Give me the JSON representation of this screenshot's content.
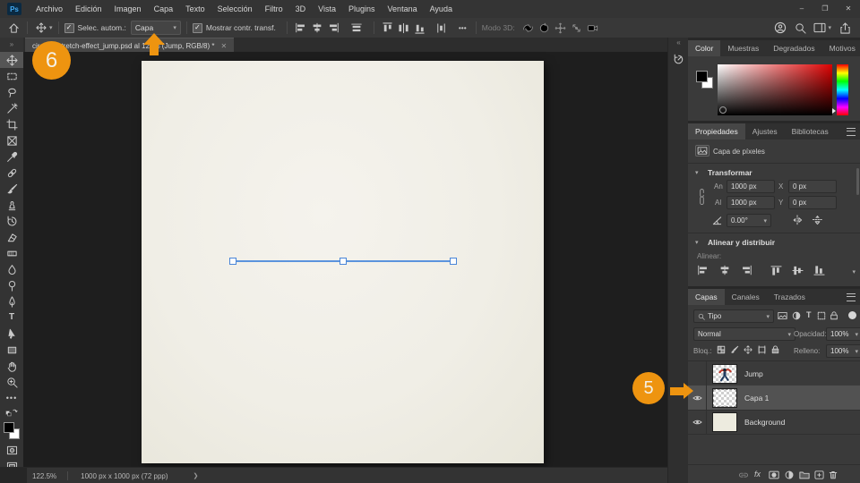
{
  "titlebar": {
    "logo": "Ps",
    "minimize": "–",
    "maximize": "❐",
    "close": "✕"
  },
  "menubar": {
    "items": [
      "Archivo",
      "Edición",
      "Imagen",
      "Capa",
      "Texto",
      "Selección",
      "Filtro",
      "3D",
      "Vista",
      "Plugins",
      "Ventana",
      "Ayuda"
    ]
  },
  "optionsbar": {
    "selec_autom_label": "Selec. autom.:",
    "selec_autom_value": "Capa",
    "show_transform_label": "Mostrar contr. transf.",
    "more_label": "•••",
    "mode3d_label": "Modo 3D:"
  },
  "tab": {
    "title": "circular-stretch-effect_jump.psd al 123% (Jump, RGB/8) *",
    "close": "✕"
  },
  "color_panel": {
    "tabs": [
      "Color",
      "Muestras",
      "Degradados",
      "Motivos"
    ],
    "active_tab": "Color"
  },
  "properties_panel": {
    "tabs": [
      "Propiedades",
      "Ajustes",
      "Bibliotecas"
    ],
    "active_tab": "Propiedades",
    "layer_type": "Capa de píxeles",
    "transform_title": "Transformar",
    "an_label": "An",
    "an_value": "1000 px",
    "x_label": "X",
    "x_value": "0 px",
    "al_label": "Al",
    "al_value": "1000 px",
    "y_label": "Y",
    "y_value": "0 px",
    "angle_value": "0.00°",
    "align_title": "Alinear y distribuir",
    "align_label": "Alinear:"
  },
  "layers_panel": {
    "tabs": [
      "Capas",
      "Canales",
      "Trazados"
    ],
    "active_tab": "Capas",
    "filter_value": "Tipo",
    "blend_mode": "Normal",
    "opacity_label": "Opacidad:",
    "opacity_value": "100%",
    "lock_label": "Bloq.:",
    "fill_label": "Relleno:",
    "fill_value": "100%",
    "fx_label": "fx",
    "layers": [
      {
        "name": "Jump",
        "visible": false,
        "selected": false
      },
      {
        "name": "Capa 1",
        "visible": true,
        "selected": true
      },
      {
        "name": "Background",
        "visible": true,
        "selected": false
      }
    ]
  },
  "statusbar": {
    "zoom": "122.5%",
    "doc_info": "1000 px x 1000 px (72 ppp)",
    "menu_chevron": "❯"
  },
  "annotations": {
    "step_top": "6",
    "step_layers": "5"
  },
  "colors": {
    "annotation_orange": "#EE9410",
    "selection_blue": "#5B93DD",
    "ps_logo_blue": "#43A9F0"
  }
}
